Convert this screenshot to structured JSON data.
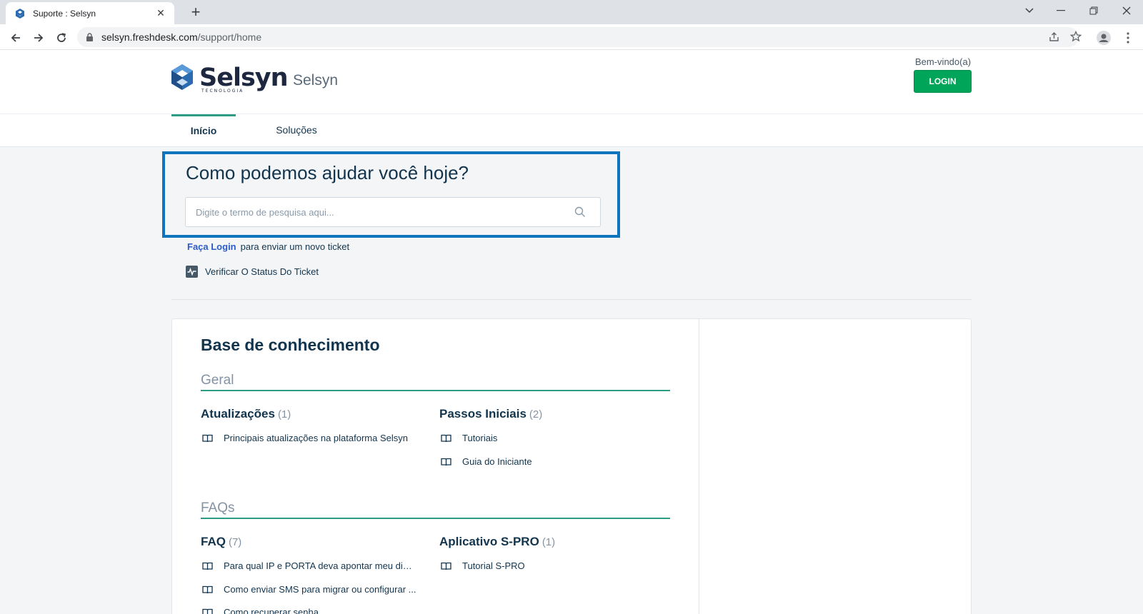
{
  "browser": {
    "tab_title": "Suporte : Selsyn",
    "url_domain": "selsyn.freshdesk.com",
    "url_path": "/support/home"
  },
  "header": {
    "logo_text": "Selsyn",
    "logo_subtext": "TECNOLOGIA",
    "brand_name": "Selsyn",
    "welcome": "Bem-vindo(a)",
    "login_label": "LOGIN"
  },
  "nav": {
    "tabs": [
      {
        "label": "Início",
        "active": true
      },
      {
        "label": "Soluções",
        "active": false
      }
    ]
  },
  "search": {
    "title": "Como podemos ajudar você hoje?",
    "placeholder": "Digite o termo de pesquisa aqui..."
  },
  "ticket": {
    "login_link": "Faça Login",
    "login_text": "para enviar um novo ticket",
    "status_label": "Verificar O Status Do Ticket"
  },
  "knowledge_base": {
    "title": "Base de conhecimento",
    "categories": [
      {
        "name": "Geral",
        "folders": [
          {
            "name": "Atualizações",
            "count": "(1)",
            "articles": [
              "Principais atualizações na plataforma Selsyn"
            ]
          },
          {
            "name": "Passos Iniciais",
            "count": "(2)",
            "articles": [
              "Tutoriais",
              "Guia do Iniciante"
            ]
          }
        ]
      },
      {
        "name": "FAQs",
        "folders": [
          {
            "name": "FAQ",
            "count": "(7)",
            "articles": [
              "Para qual IP e PORTA deva apontar meu disp...",
              "Como enviar SMS para migrar ou configurar ...",
              "Como recuperar senha"
            ]
          },
          {
            "name": "Aplicativo S-PRO",
            "count": "(1)",
            "articles": [
              "Tutorial S-PRO"
            ]
          }
        ]
      }
    ]
  },
  "colors": {
    "accent": "#2c9c84",
    "login_button": "#00a55a",
    "highlight_frame": "#0f75bc",
    "link": "#2c5cc5"
  }
}
